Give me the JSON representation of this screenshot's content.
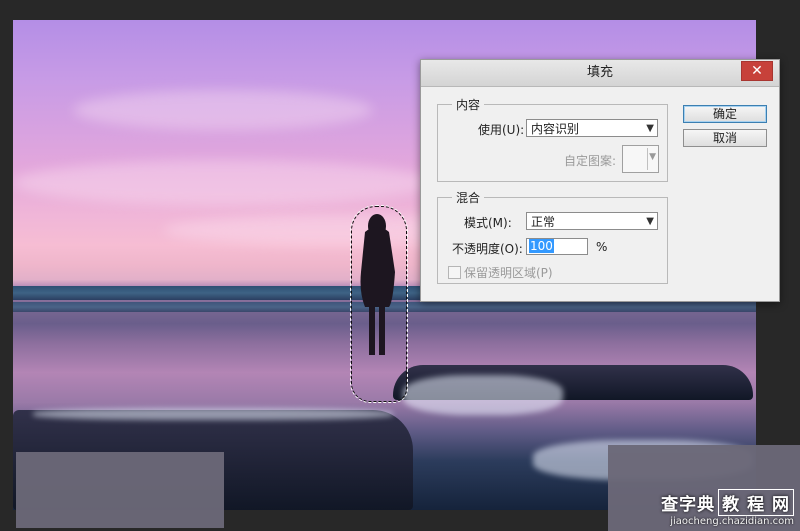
{
  "dialog": {
    "title": "填充",
    "close_glyph": "✕",
    "content_group": {
      "title": "内容",
      "use_label": "使用(U):",
      "use_value": "内容识别",
      "custom_pattern_label": "自定图案:"
    },
    "blend_group": {
      "title": "混合",
      "mode_label": "模式(M):",
      "mode_value": "正常",
      "opacity_label": "不透明度(O):",
      "opacity_value": "100",
      "opacity_unit": "%",
      "preserve_label": "保留透明区域(P)"
    },
    "ok_label": "确定",
    "cancel_label": "取消"
  },
  "watermark": {
    "brand": "查字典",
    "brand_box": "教 程 网",
    "url": "jiaocheng.chazidian.com"
  },
  "icons": {
    "dropdown": "chevron-down-icon",
    "close": "close-icon"
  },
  "colors": {
    "close_button": "#c7413a",
    "selected_text_bg": "#3399ff",
    "default_button_border": "#3c7fb1"
  }
}
